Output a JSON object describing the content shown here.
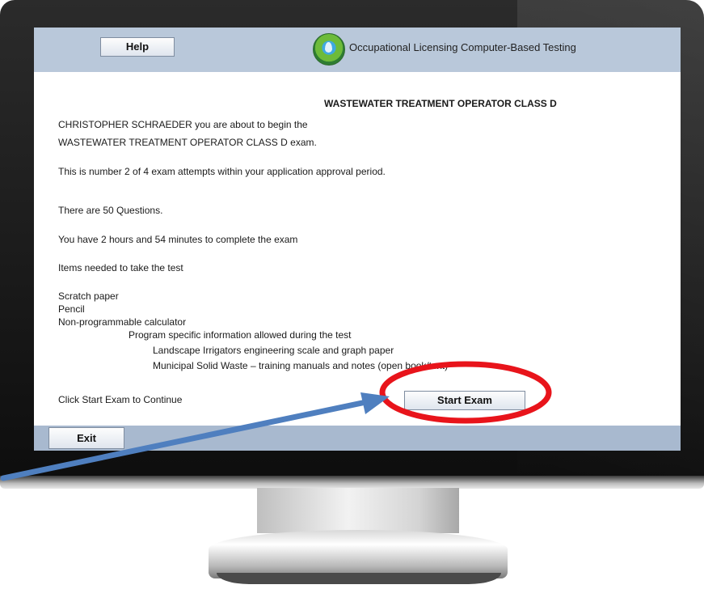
{
  "header": {
    "help_label": "Help",
    "app_title": "Occupational Licensing Computer-Based Testing",
    "logo_icon": "agency-seal-icon"
  },
  "main": {
    "exam_title": "WASTEWATER TREATMENT OPERATOR  CLASS D",
    "intro_line1": "CHRISTOPHER SCHRAEDER you are about to begin the",
    "intro_line2": "WASTEWATER TREATMENT OPERATOR  CLASS D exam.",
    "attempt_text": "This is number 2 of 4 exam attempts within your application approval period.",
    "questions_text": "There are 50 Questions.",
    "time_text": "You have 2 hours and 54 minutes to complete the exam",
    "items_heading": "Items needed to take the test",
    "items": [
      "Scratch paper",
      "Pencil",
      "Non-programmable calculator"
    ],
    "program_info_heading": "Program specific information allowed during the test",
    "program_info": [
      "Landscape Irrigators   engineering scale and graph paper",
      "Municipal Solid Waste – training manuals and notes (open book/text)"
    ],
    "continue_text": "Click Start Exam to Continue",
    "start_label": "Start Exam"
  },
  "footer": {
    "exit_label": "Exit"
  },
  "annotation_colors": {
    "arrow": "#4f7fbf",
    "highlight_circle": "#e8141b"
  }
}
